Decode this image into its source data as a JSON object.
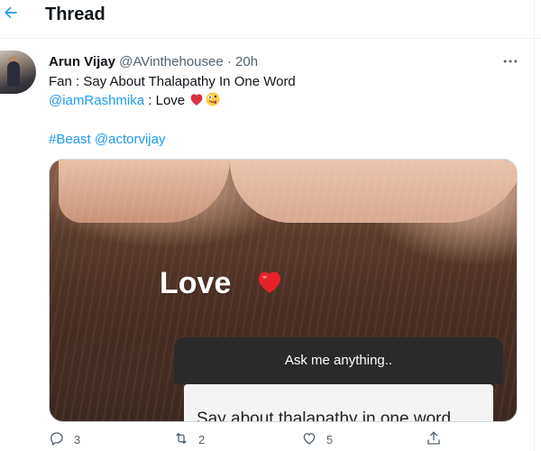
{
  "header": {
    "title": "Thread"
  },
  "tweet": {
    "author_name": "Arun Vijay",
    "handle": "@AVinthehousee",
    "separator": "·",
    "time": "20h",
    "line1": "Fan : Say About Thalapathy In One Word",
    "mention": "@iamRashmika",
    "line2_rest": " : Love ",
    "hashtag": "#Beast",
    "mention2": "@actorvijay"
  },
  "media": {
    "overlay_word": "Love",
    "question_header": "Ask me anything..",
    "question_text": "Say about thalapathy in one word"
  },
  "actions": {
    "reply_count": "3",
    "retweet_count": "2",
    "like_count": "5"
  },
  "colors": {
    "accent": "#1d9bf0",
    "muted": "#536471",
    "text": "#0f1419",
    "heart": "#e0245e"
  },
  "icons": [
    "back-arrow-icon",
    "more-icon",
    "red-heart-emoji",
    "zany-face-emoji",
    "reply-icon",
    "retweet-icon",
    "like-icon",
    "share-icon"
  ]
}
